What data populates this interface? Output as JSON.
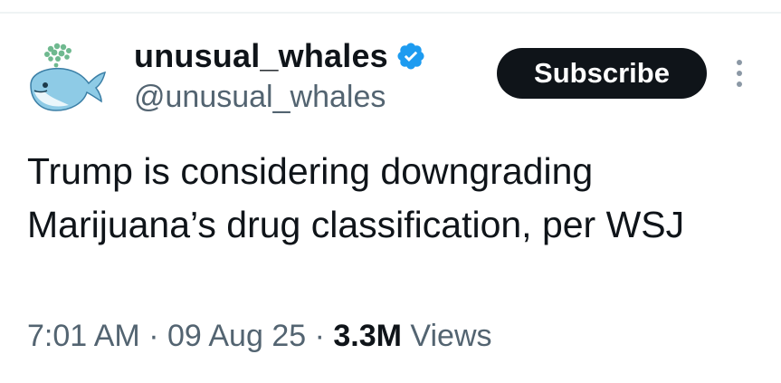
{
  "tweet": {
    "author": {
      "display_name": "unusual_whales",
      "handle": "@unusual_whales",
      "verified": true,
      "avatar_icon": "whale-icon"
    },
    "subscribe_label": "Subscribe",
    "more_icon": "more-vertical-icon",
    "text": "Trump is considering downgrading Marijuana’s drug classification, per WSJ",
    "time": "7:01 AM",
    "separator": "·",
    "date": "09 Aug 25",
    "views_count": "3.3M",
    "views_label": "Views"
  },
  "colors": {
    "text_primary": "#0f1419",
    "text_secondary": "#536471",
    "verified_blue": "#1d9bf0",
    "button_bg": "#0f1419",
    "button_text": "#ffffff"
  }
}
